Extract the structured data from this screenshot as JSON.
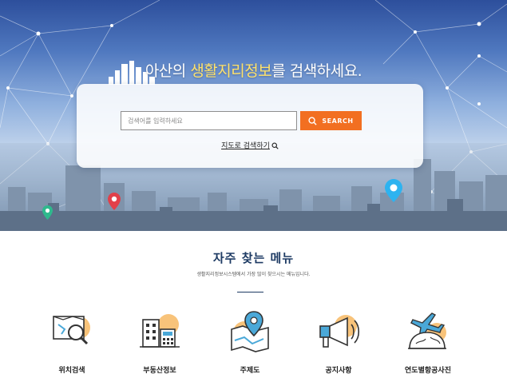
{
  "hero": {
    "title_prefix": "아산의 ",
    "title_highlight": "생활지리정보",
    "title_suffix": "를 검색하세요.",
    "colors": {
      "highlight": "#ffe26b",
      "accent": "#f26f21"
    }
  },
  "search": {
    "placeholder": "검색어를 입력하세요",
    "value": "",
    "button_label": "SEARCH",
    "map_link_label": "지도로 검색하기"
  },
  "menu": {
    "title": "자주 찾는 메뉴",
    "subtitle": "생활지리정보시스템에서 가장 많이 찾으시는 메뉴입니다.",
    "items": [
      {
        "label": "위치검색",
        "icon": "map-search-icon"
      },
      {
        "label": "부동산정보",
        "icon": "building-calculator-icon"
      },
      {
        "label": "주제도",
        "icon": "map-pin-icon"
      },
      {
        "label": "공지사항",
        "icon": "megaphone-icon"
      },
      {
        "label": "연도별항공사진",
        "icon": "airplane-globe-icon"
      }
    ]
  }
}
